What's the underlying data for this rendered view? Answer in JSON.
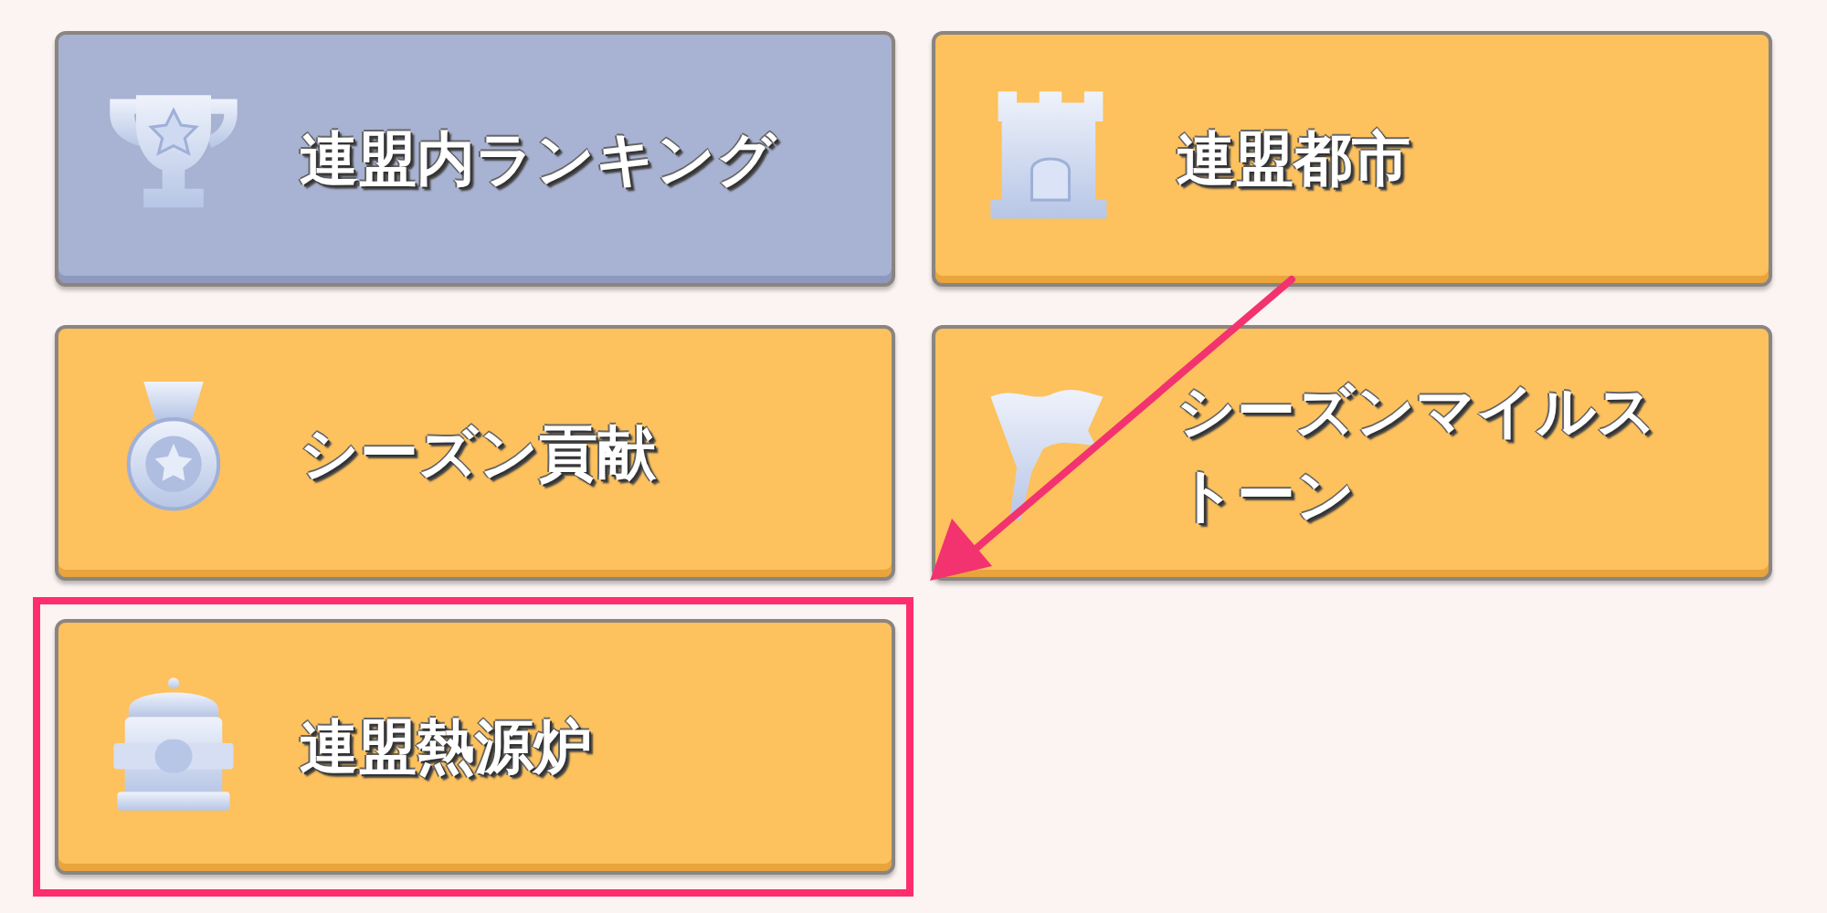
{
  "menu_rows": [
    {
      "buttons": [
        {
          "label": "連盟内ランキング",
          "selected": true,
          "highlighted": false
        },
        {
          "label": "連盟都市",
          "selected": false,
          "highlighted": false
        }
      ]
    },
    {
      "buttons": [
        {
          "label": "シーズン貢献",
          "selected": false,
          "highlighted": false
        },
        {
          "label": "シーズンマイルストーン",
          "selected": false,
          "highlighted": false
        }
      ]
    },
    {
      "buttons": [
        {
          "label": "連盟熱源炉",
          "selected": false,
          "highlighted": true
        }
      ]
    }
  ]
}
